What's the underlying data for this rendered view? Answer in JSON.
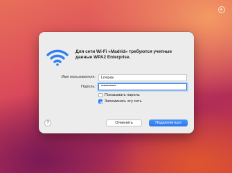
{
  "dialog": {
    "message": "Для сети Wi-Fi «Madrid» требуются учетные данные WPA2 Enterprise.",
    "username_label": "Имя пользователя:",
    "username_value": "Lnepav",
    "password_label": "Пароль:",
    "password_value": "••••••••••••",
    "show_password_label": "Показывать пароль",
    "show_password_checked": false,
    "remember_label": "Запоминать эту сеть",
    "remember_checked": true,
    "help_label": "?",
    "cancel_label": "Отменить",
    "connect_label": "Подключиться"
  },
  "icons": {
    "network": "wifi-icon",
    "menubar": "status-icon"
  },
  "colors": {
    "accent": "#2f7ff0"
  }
}
